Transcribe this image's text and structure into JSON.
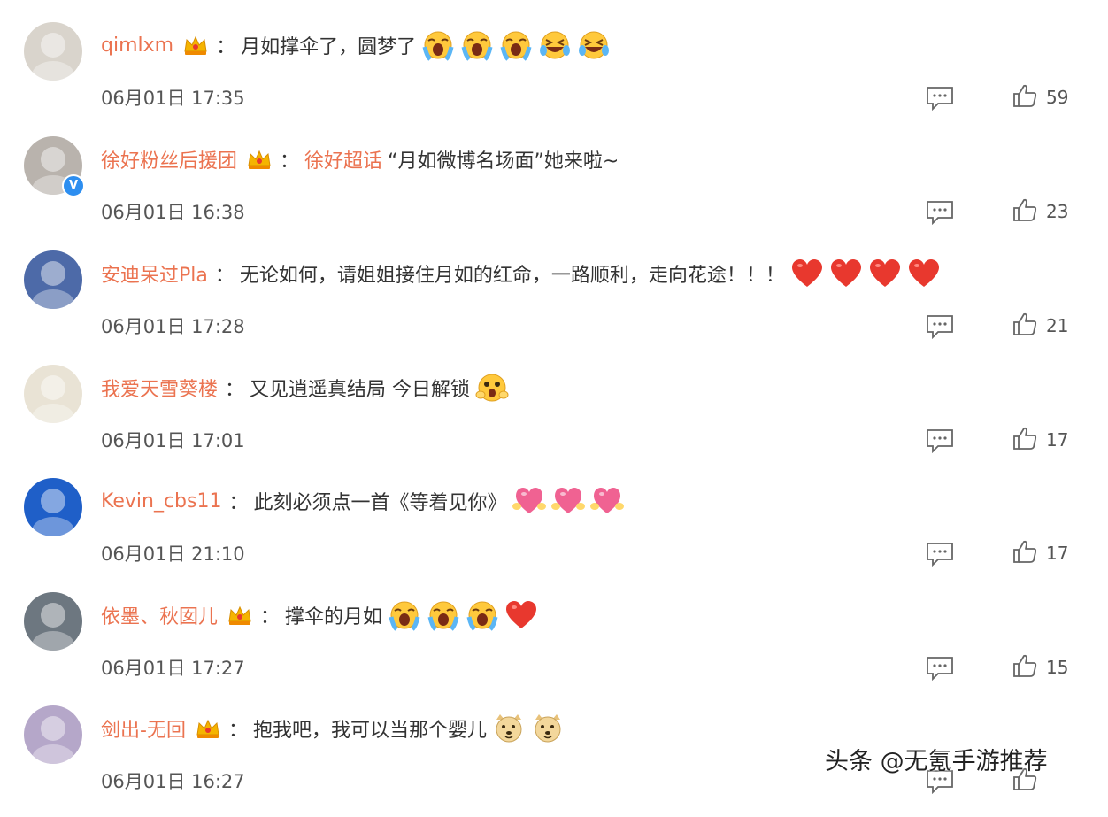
{
  "comments": [
    {
      "username": "qimlxm",
      "has_badge": true,
      "colon": "：",
      "text": "月如撑伞了，圆梦了",
      "emojis": [
        "crying-face-emoji",
        "crying-face-emoji",
        "crying-face-emoji",
        "laughing-tears-emoji",
        "laughing-tears-emoji"
      ],
      "time": "06月01日 17:35",
      "likes": "59",
      "avatar_color": "#d9d4cc"
    },
    {
      "username": "徐好粉丝后援团",
      "has_badge": true,
      "verified": true,
      "colon": "：",
      "topic_tag": "徐好超话",
      "text": "“月如微博名场面”她来啦~",
      "emojis": [],
      "time": "06月01日 16:38",
      "likes": "23",
      "avatar_color": "#b9b3ad"
    },
    {
      "username": "安迪呆过Pla",
      "has_badge": false,
      "colon": "：",
      "text": "无论如何，请姐姐接住月如的红命，一路顺利，走向花途！！！",
      "emojis": [
        "heart-emoji",
        "heart-emoji",
        "heart-emoji",
        "heart-emoji"
      ],
      "time": "06月01日 17:28",
      "likes": "21",
      "avatar_color": "#4d6aa8"
    },
    {
      "username": "我爱天雪葵楼",
      "has_badge": false,
      "colon": "：",
      "text": "又见逍遥真结局 今日解锁",
      "emojis": [
        "scared-face-emoji"
      ],
      "time": "06月01日 17:01",
      "likes": "17",
      "avatar_color": "#e9e3d5"
    },
    {
      "username": "Kevin_cbs11",
      "has_badge": false,
      "colon": "：",
      "text": "此刻必须点一首《等着见你》",
      "emojis": [
        "heart-hug-emoji",
        "heart-hug-emoji",
        "heart-hug-emoji"
      ],
      "time": "06月01日 21:10",
      "likes": "17",
      "avatar_color": "#1f5fc8"
    },
    {
      "username": "依墨、秋囡儿",
      "has_badge": true,
      "colon": "：",
      "text": "撑伞的月如",
      "emojis": [
        "crying-face-emoji",
        "crying-face-emoji",
        "crying-face-emoji",
        "heart-emoji"
      ],
      "time": "06月01日 17:27",
      "likes": "15",
      "avatar_color": "#6d7780"
    },
    {
      "username": "剑出-无回",
      "has_badge": true,
      "colon": "：",
      "text": "抱我吧，我可以当那个婴儿",
      "emojis": [
        "doge-emoji",
        "doge-emoji"
      ],
      "time": "06月01日 16:27",
      "likes": "",
      "avatar_color": "#b5a7c9"
    }
  ],
  "watermark": "头条 @无氪手游推荐",
  "colors": {
    "username": "#eb7350",
    "text": "#333333",
    "time": "#555555",
    "verified": "#2d8ef0",
    "heart": "#e8382e"
  }
}
